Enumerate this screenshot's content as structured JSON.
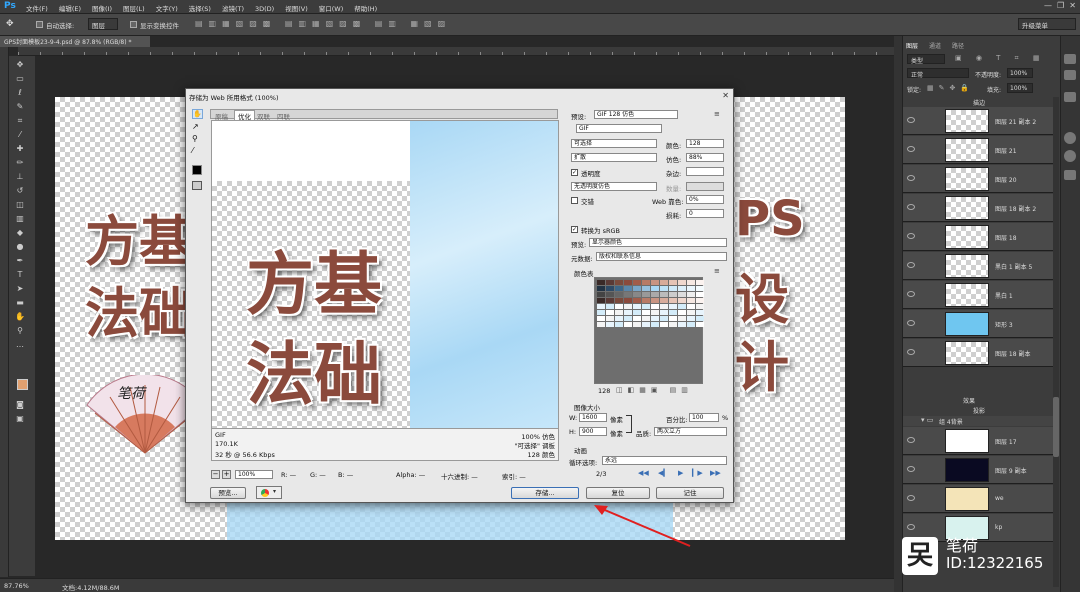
{
  "menubar": {
    "logo": "Ps",
    "items": [
      "文件(F)",
      "编辑(E)",
      "图像(I)",
      "图层(L)",
      "文字(Y)",
      "选择(S)",
      "滤镜(T)",
      "3D(D)",
      "视图(V)",
      "窗口(W)",
      "帮助(H)"
    ]
  },
  "options_bar": {
    "auto_select_label": "自动选择:",
    "auto_select_value": "图层",
    "show_transform_label": "显示变换控件",
    "workspace_value": "升级菜单"
  },
  "doc_tab": {
    "title": "GPS封面模板23-9-4.psd @ 87.8% (RGB/8) *"
  },
  "canvas_text": {
    "left_line1": "方基",
    "left_line2": "法础",
    "right_line1": "PS",
    "right_line2": "设",
    "right_line3": "计",
    "fan_text": "笔荷"
  },
  "status_bar": {
    "zoom": "87.76%",
    "doc_info": "文档:4.12M/88.6M"
  },
  "dialog": {
    "title": "存储为 Web 所用格式 (100%)",
    "tabs": [
      "原稿",
      "优化",
      "双联",
      "四联"
    ],
    "active_tab": "优化",
    "preview_text_line1": "方基",
    "preview_text_line2": "法础",
    "info_format": "GIF",
    "info_size": "170.1K",
    "info_time": "32 秒 @ 56.6 Kbps",
    "info_dither": "100% 仿色",
    "info_palette": "\"可选择\" 调板",
    "info_colors": "128 颜色",
    "preset_label": "预设:",
    "preset_value": "GIF 128 仿色",
    "format_value": "GIF",
    "reduction_value": "可选择",
    "dither_algo_value": "扩散",
    "transparency_label": "透明度",
    "matte_label": "杂边:",
    "transparency_dither_value": "无透明度仿色",
    "amount_label": "数量:",
    "interlaced_label": "交错",
    "web_snap_label": "Web 靠色:",
    "web_snap_value": "0%",
    "lossy_label": "损耗:",
    "lossy_value": "0",
    "colors_label": "颜色:",
    "colors_value": "128",
    "dither_label": "仿色:",
    "dither_value": "88%",
    "convert_srgb_label": "转换为 sRGB",
    "preview_label": "预览:",
    "preview_value": "显示器颜色",
    "metadata_label": "元数据:",
    "metadata_value": "版权和联系信息",
    "color_table_label": "颜色表",
    "color_count": "128",
    "image_size_label": "图像大小",
    "width_label": "W:",
    "width_value": "1600",
    "height_label": "H:",
    "height_value": "900",
    "unit_label": "像素",
    "percent_label": "百分比:",
    "percent_value": "100",
    "percent_unit": "%",
    "quality_label": "品质:",
    "quality_value": "两次立方",
    "animation_label": "动画",
    "loop_label": "循环选项:",
    "loop_value": "永远",
    "frame_counter": "2/3",
    "zoom_value": "100%",
    "r_label": "R: —",
    "g_label": "G: —",
    "b_label": "B: —",
    "alpha_label": "Alpha: —",
    "hex_label": "十六进制: —",
    "index_label": "索引: —",
    "preview_button": "预览...",
    "save_button": "存储...",
    "reset_button": "复位",
    "remember_button": "记住"
  },
  "layers_panel": {
    "tabs": [
      "图层",
      "通道",
      "路径"
    ],
    "filter_value": "类型",
    "blend_mode": "正常",
    "opacity_label": "不透明度:",
    "opacity_value": "100%",
    "lock_label": "锁定:",
    "fill_label": "填充:",
    "fill_value": "100%",
    "top_row": "描边",
    "layers": [
      {
        "name": "图层 21 副本 2"
      },
      {
        "name": "图层 21"
      },
      {
        "name": "图层 20"
      },
      {
        "name": "图层 18 副本 2"
      },
      {
        "name": "图层 18"
      },
      {
        "name": "黑白 1 副本 5"
      },
      {
        "name": "黑白 1"
      },
      {
        "name": "矩形 3"
      },
      {
        "name": "图层 18 副本"
      }
    ],
    "effects_label": "效果",
    "shadow_label": "投影",
    "group_label": "组 4背景",
    "group_layers": [
      {
        "name": "图层 17"
      },
      {
        "name": "图层 9 副本"
      },
      {
        "name": "we"
      },
      {
        "name": "kp"
      }
    ]
  },
  "watermark": {
    "brand": "笔荷",
    "id": "ID:12322165"
  },
  "colors": {
    "accent_brown": "#8b4a3c",
    "sky_blue": "#a9d8f5",
    "ps_blue": "#31a8ff",
    "arrow_red": "#e02020",
    "fg_swatch": "#e0a070"
  },
  "arrow_annotation": "red-arrow-pointing-to-save-button"
}
